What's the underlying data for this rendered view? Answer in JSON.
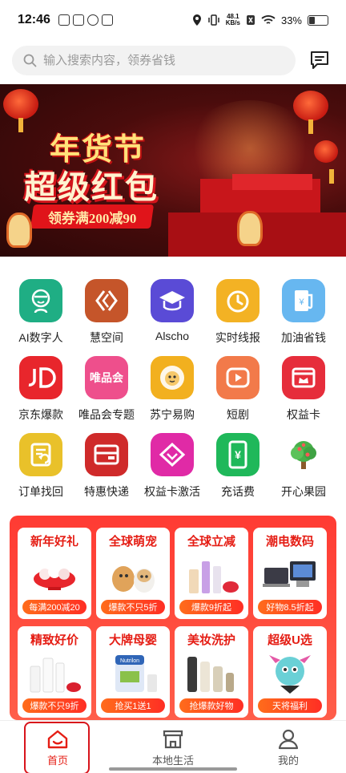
{
  "status_bar": {
    "time": "12:46",
    "net_speed_value": "48.1",
    "net_speed_unit": "KB/s",
    "battery": "33%"
  },
  "search": {
    "placeholder": "输入搜索内容，领券省钱"
  },
  "banner": {
    "line1": "年货节",
    "line2": "超级红包",
    "ribbon": "领券满200减90"
  },
  "icons": [
    {
      "label": "AI数字人",
      "icon": "robot-face-icon",
      "color": "#1fae84"
    },
    {
      "label": "慧空间",
      "icon": "chevron-space-icon",
      "color": "#c5552a"
    },
    {
      "label": "Alscho",
      "icon": "graduation-cap-icon",
      "color": "#5a4bd6"
    },
    {
      "label": "实时线报",
      "icon": "clock-icon",
      "color": "#f3b224"
    },
    {
      "label": "加油省钱",
      "icon": "fuel-pump-icon",
      "color": "#67b7f0"
    },
    {
      "label": "京东爆款",
      "icon": "jd-logo-icon",
      "color": "#e8262c"
    },
    {
      "label": "唯品会专题",
      "icon": "vip-logo-icon",
      "color": "#ee4f8c",
      "glyph": "唯品会"
    },
    {
      "label": "苏宁易购",
      "icon": "suning-lion-icon",
      "color": "#f2b01f"
    },
    {
      "label": "短剧",
      "icon": "play-icon",
      "color": "#f27a4a"
    },
    {
      "label": "权益卡",
      "icon": "card-crown-icon",
      "color": "#e62d3b"
    },
    {
      "label": "订单找回",
      "icon": "order-return-icon",
      "color": "#e9c12a"
    },
    {
      "label": "特惠快递",
      "icon": "express-box-icon",
      "color": "#cf2a2a"
    },
    {
      "label": "权益卡激活",
      "icon": "diamond-icon",
      "color": "#e02aa6"
    },
    {
      "label": "充话费",
      "icon": "phone-charge-icon",
      "color": "#1fb85a",
      "glyph": "¥"
    },
    {
      "label": "开心果园",
      "icon": "tree-icon",
      "color": "#ffffff"
    }
  ],
  "promo_cards": [
    {
      "title": "新年好礼",
      "tag": "每满200减20",
      "pic": "gift-bowl-pic"
    },
    {
      "title": "全球萌宠",
      "tag": "爆款不只5折",
      "pic": "puppies-pic"
    },
    {
      "title": "全球立减",
      "tag": "爆款9折起",
      "pic": "cosmetics-pic"
    },
    {
      "title": "潮电数码",
      "tag": "好物8.5折起",
      "pic": "laptops-pic"
    },
    {
      "title": "精致好价",
      "tag": "爆款不只9折",
      "pic": "skincare-pic"
    },
    {
      "title": "大牌母婴",
      "tag": "抢买1送1",
      "pic": "milk-powder-pic",
      "brand": "Nutrilon"
    },
    {
      "title": "美妆洗护",
      "tag": "抢爆款好物",
      "pic": "haircare-pic"
    },
    {
      "title": "超级U选",
      "tag": "天将福利",
      "pic": "mascot-pic"
    }
  ],
  "bottom_nav": [
    {
      "label": "首页",
      "icon": "home-icon",
      "active": true
    },
    {
      "label": "本地生活",
      "icon": "storefront-icon",
      "active": false
    },
    {
      "label": "我的",
      "icon": "profile-icon",
      "active": false
    }
  ],
  "colors": {
    "accent": "#e51d14",
    "promo_bg": "#ff3b33"
  }
}
